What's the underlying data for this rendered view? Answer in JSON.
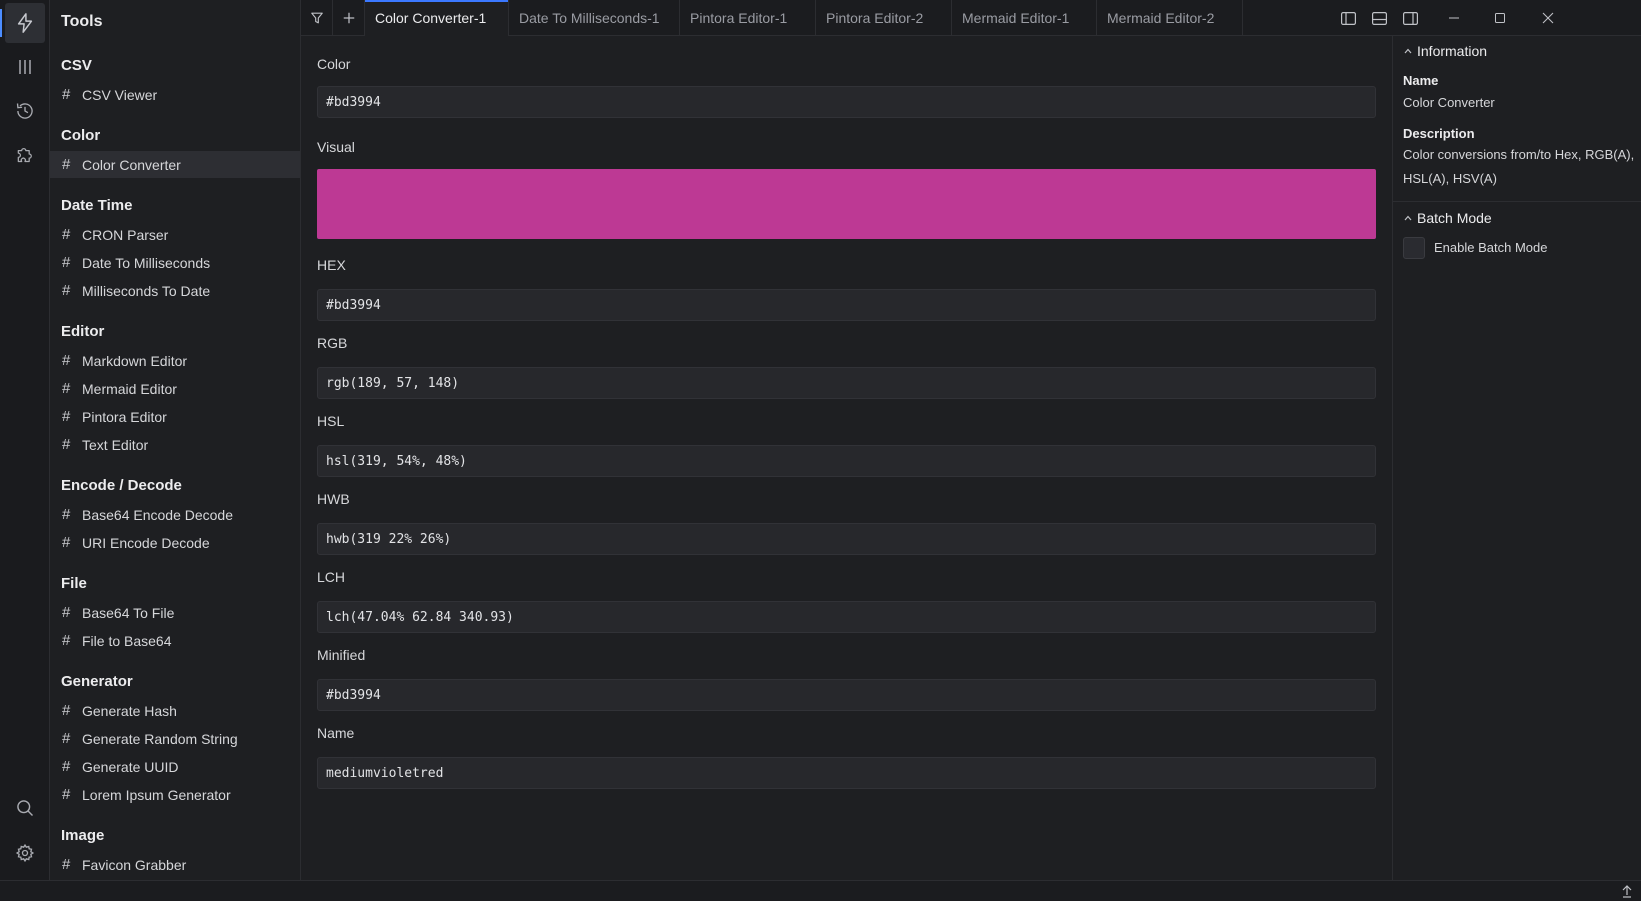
{
  "sidebar": {
    "title": "Tools",
    "groups": [
      {
        "label": "CSV",
        "items": [
          "CSV Viewer"
        ]
      },
      {
        "label": "Color",
        "items": [
          "Color Converter"
        ]
      },
      {
        "label": "Date Time",
        "items": [
          "CRON Parser",
          "Date To Milliseconds",
          "Milliseconds To Date"
        ]
      },
      {
        "label": "Editor",
        "items": [
          "Markdown Editor",
          "Mermaid Editor",
          "Pintora Editor",
          "Text Editor"
        ]
      },
      {
        "label": "Encode / Decode",
        "items": [
          "Base64 Encode Decode",
          "URI Encode Decode"
        ]
      },
      {
        "label": "File",
        "items": [
          "Base64 To File",
          "File to Base64"
        ]
      },
      {
        "label": "Generator",
        "items": [
          "Generate Hash",
          "Generate Random String",
          "Generate UUID",
          "Lorem Ipsum Generator"
        ]
      },
      {
        "label": "Image",
        "items": [
          "Favicon Grabber"
        ]
      }
    ],
    "selected": "Color Converter"
  },
  "activity": {
    "icons": [
      "lightning-icon",
      "columns-icon",
      "history-icon",
      "puzzle-icon",
      "search-icon",
      "gear-icon"
    ]
  },
  "tabs": [
    {
      "label": "Color Converter-1",
      "active": true
    },
    {
      "label": "Date To Milliseconds-1",
      "active": false
    },
    {
      "label": "Pintora Editor-1",
      "active": false
    },
    {
      "label": "Pintora Editor-2",
      "active": false
    },
    {
      "label": "Mermaid Editor-1",
      "active": false
    },
    {
      "label": "Mermaid Editor-2",
      "active": false
    }
  ],
  "main": {
    "color_label": "Color",
    "color_value": "#bd3994",
    "visual_label": "Visual",
    "visual_color": "#bd3994",
    "fields": [
      {
        "label": "HEX",
        "value": "#bd3994"
      },
      {
        "label": "RGB",
        "value": "rgb(189, 57, 148)"
      },
      {
        "label": "HSL",
        "value": "hsl(319, 54%, 48%)"
      },
      {
        "label": "HWB",
        "value": "hwb(319 22% 26%)"
      },
      {
        "label": "LCH",
        "value": "lch(47.04% 62.84 340.93)"
      },
      {
        "label": "Minified",
        "value": "#bd3994"
      },
      {
        "label": "Name",
        "value": "mediumvioletred"
      }
    ]
  },
  "info_panel": {
    "information_header": "Information",
    "name_label": "Name",
    "name_value": "Color Converter",
    "description_label": "Description",
    "description_value": "Color conversions from/to Hex, RGB(A), HSL(A), HSV(A)",
    "batch_header": "Batch Mode",
    "batch_checkbox_label": "Enable Batch Mode",
    "batch_enabled": false
  },
  "colors": {
    "accent": "#3b78ff",
    "background": "#1e1f22",
    "input_bg": "#27282c"
  }
}
